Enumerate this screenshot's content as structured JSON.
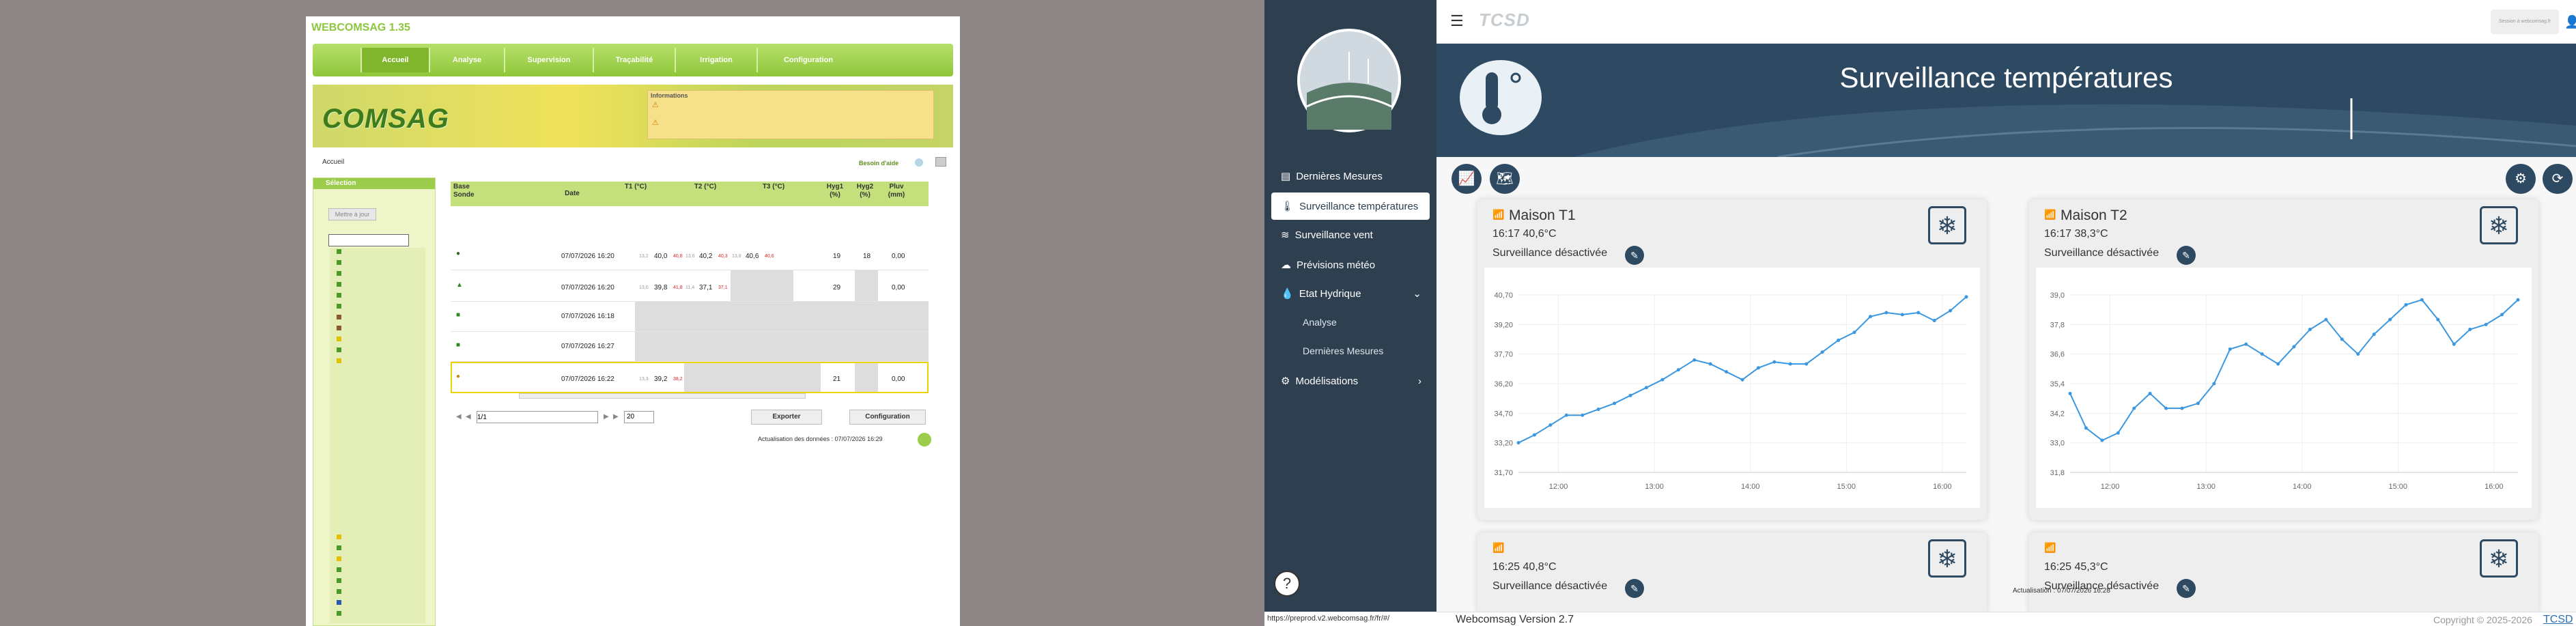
{
  "old_app": {
    "title": "WEBCOMSAG 1.35",
    "nav": [
      "Accueil",
      "Analyse",
      "Supervision",
      "Traçabilité",
      "Irrigation",
      "Configuration"
    ],
    "logo": "COMSAG",
    "info_title": "Informations",
    "breadcrumb": "Accueil",
    "help": "Besoin d'aide",
    "sidebar_title": "Sélection",
    "update_button": "Mettre à jour",
    "table_headers": [
      "Base Sonde",
      "Date",
      "T1 (°C)",
      "T2 (°C)",
      "T3 (°C)",
      "Hyg1 (%)",
      "Hyg2 (%)",
      "Pluv (mm)"
    ],
    "rows": [
      {
        "date": "07/07/2026 16:20",
        "t1_min": "13,2",
        "t1": "40,0",
        "t1_max": "40,8",
        "t2_min": "13,6",
        "t2": "40,2",
        "t2_max": "40,3",
        "t3_min": "13,8",
        "t3": "40,6",
        "t3_max": "40,6",
        "hyg1": "19",
        "hyg2": "18",
        "pluv": "0,00"
      },
      {
        "date": "07/07/2026 16:20",
        "t1_min": "13,0",
        "t1": "39,8",
        "t1_max": "41,8",
        "t2_min": "11,4",
        "t2": "37,1",
        "t2_max": "37,1",
        "t3": "",
        "hyg1": "29",
        "hyg2": "",
        "pluv": "0,00"
      },
      {
        "date": "07/07/2026 16:18",
        "t1": "",
        "hyg1": "",
        "pluv": ""
      },
      {
        "date": "07/07/2026 16:27",
        "t1": "",
        "hyg1": "",
        "pluv": ""
      },
      {
        "date": "07/07/2026 16:22",
        "t1_min": "13,3",
        "t1": "39,2",
        "t1_max": "38,2",
        "t2": "",
        "t3": "",
        "hyg1": "21",
        "hyg2": "",
        "pluv": "0,00"
      }
    ],
    "pager_value": "1/1",
    "page_size": "20",
    "export_label": "Exporter",
    "config_label": "Configuration",
    "update_text": "Actualisation des données : 07/07/2026 16:29"
  },
  "new_app": {
    "brand": "TCSD",
    "user_box": "Session à webcomsag.fr",
    "hero_title": "Surveillance températures",
    "sidebar": [
      {
        "label": "Dernières Mesures",
        "icon": "list-icon"
      },
      {
        "label": "Surveillance températures",
        "icon": "thermometer-icon",
        "active": true
      },
      {
        "label": "Surveillance vent",
        "icon": "wind-icon"
      },
      {
        "label": "Prévisions météo",
        "icon": "cloud-icon"
      },
      {
        "label": "Etat Hydrique",
        "icon": "drop-icon",
        "expandable": true
      },
      {
        "label": "Analyse",
        "sub": true
      },
      {
        "label": "Dernières Mesures",
        "sub": true
      },
      {
        "label": "Modélisations",
        "icon": "model-icon",
        "expandable": true
      }
    ],
    "status_url": "https://preprod.v2.webcomsag.fr/fr/#/",
    "update_text": "Actualisation : 07/07/2026 16:28",
    "version": "Webcomsag Version 2.7",
    "copyright": "Copyright © 2025-2026",
    "copyright_link": "TCSD",
    "cards": [
      {
        "title": "Maison T1",
        "sub": "16:17 40,6°C",
        "state": "Surveillance désactivée",
        "y_ticks": [
          "40,70",
          "39,20",
          "37,70",
          "36,20",
          "34,70",
          "33,20",
          "31,70"
        ],
        "x_ticks": [
          "12:00",
          "13:00",
          "14:00",
          "15:00",
          "16:00"
        ]
      },
      {
        "title": "Maison T2",
        "sub": "16:17 38,3°C",
        "state": "Surveillance désactivée",
        "y_ticks": [
          "39,0",
          "37,8",
          "36,6",
          "35,4",
          "34,2",
          "33,0",
          "31,8"
        ],
        "x_ticks": [
          "12:00",
          "13:00",
          "14:00",
          "15:00",
          "16:00"
        ]
      },
      {
        "title": "",
        "sub": "16:25 40,8°C",
        "state": "Surveillance désactivée"
      },
      {
        "title": "",
        "sub": "16:25 45,3°C",
        "state": "Surveillance désactivée"
      }
    ]
  },
  "chart_data": [
    {
      "type": "line",
      "ylim": [
        31.7,
        40.7
      ],
      "x": [
        "11:35",
        "11:45",
        "11:55",
        "12:05",
        "12:15",
        "12:25",
        "12:35",
        "12:45",
        "12:55",
        "13:05",
        "13:15",
        "13:25",
        "13:35",
        "13:45",
        "13:55",
        "14:05",
        "14:15",
        "14:25",
        "14:35",
        "14:45",
        "14:55",
        "15:05",
        "15:15",
        "15:25",
        "15:35",
        "15:45",
        "15:55",
        "16:05",
        "16:15"
      ],
      "series": [
        {
          "values": [
            33.2,
            33.6,
            34.1,
            34.6,
            34.6,
            34.9,
            35.2,
            35.6,
            36.0,
            36.4,
            36.9,
            37.4,
            37.2,
            36.8,
            36.4,
            37.0,
            37.3,
            37.2,
            37.2,
            37.8,
            38.4,
            38.8,
            39.6,
            39.8,
            39.7,
            39.8,
            39.4,
            39.9,
            40.6
          ]
        }
      ]
    },
    {
      "type": "line",
      "ylim": [
        31.8,
        39.0
      ],
      "x": [
        "11:35",
        "11:45",
        "11:55",
        "12:05",
        "12:15",
        "12:25",
        "12:35",
        "12:45",
        "12:55",
        "13:05",
        "13:15",
        "13:25",
        "13:35",
        "13:45",
        "13:55",
        "14:05",
        "14:15",
        "14:25",
        "14:35",
        "14:45",
        "14:55",
        "15:05",
        "15:15",
        "15:25",
        "15:35",
        "15:45",
        "15:55",
        "16:05",
        "16:15"
      ],
      "series": [
        {
          "values": [
            35.0,
            33.6,
            33.1,
            33.4,
            34.4,
            35.0,
            34.4,
            34.4,
            34.6,
            35.4,
            36.8,
            37.0,
            36.6,
            36.2,
            36.9,
            37.6,
            38.0,
            37.2,
            36.6,
            37.4,
            38.0,
            38.6,
            38.8,
            38.0,
            37.0,
            37.6,
            37.8,
            38.2,
            38.8
          ]
        }
      ]
    }
  ]
}
